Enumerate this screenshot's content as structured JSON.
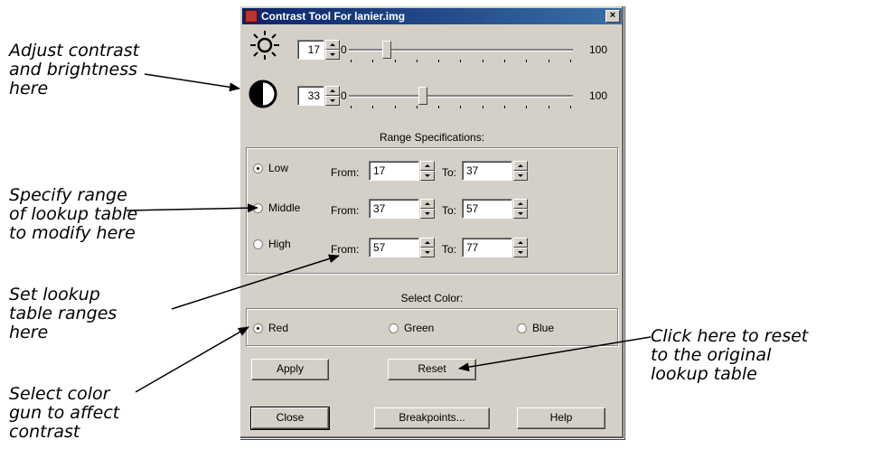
{
  "window": {
    "title": "Contrast Tool For lanier.img",
    "close_label": "×"
  },
  "brightness": {
    "value": "17",
    "min_label": "0",
    "max_label": "100",
    "level": 0.17
  },
  "contrast": {
    "value": "33",
    "min_label": "0",
    "max_label": "100",
    "level": 0.33
  },
  "range_specifications_label": "Range Specifications:",
  "ranges": [
    {
      "label": "Low",
      "selected": true,
      "from_label": "From:",
      "from": "17",
      "to_label": "To:",
      "to": "37"
    },
    {
      "label": "Middle",
      "selected": false,
      "from_label": "From:",
      "from": "37",
      "to_label": "To:",
      "to": "57"
    },
    {
      "label": "High",
      "selected": false,
      "from_label": "From:",
      "from": "57",
      "to_label": "To:",
      "to": "77"
    }
  ],
  "select_color_label": "Select Color:",
  "colors": [
    {
      "label": "Red",
      "selected": true
    },
    {
      "label": "Green",
      "selected": false
    },
    {
      "label": "Blue",
      "selected": false
    }
  ],
  "buttons": {
    "apply": "Apply",
    "reset": "Reset",
    "close": "Close",
    "breakpoints": "Breakpoints...",
    "help": "Help"
  },
  "callouts": {
    "contrast_brightness": "Adjust contrast\nand brightness\nhere",
    "range": "Specify range\nof lookup table\nto modify here",
    "set_ranges": "Set lookup\ntable ranges\nhere",
    "color_gun": "Select color\ngun to affect\ncontrast",
    "reset": "Click here to reset\nto the original\nlookup table"
  },
  "icons": {
    "brightness": "sun-icon",
    "contrast": "half-circle-icon"
  }
}
